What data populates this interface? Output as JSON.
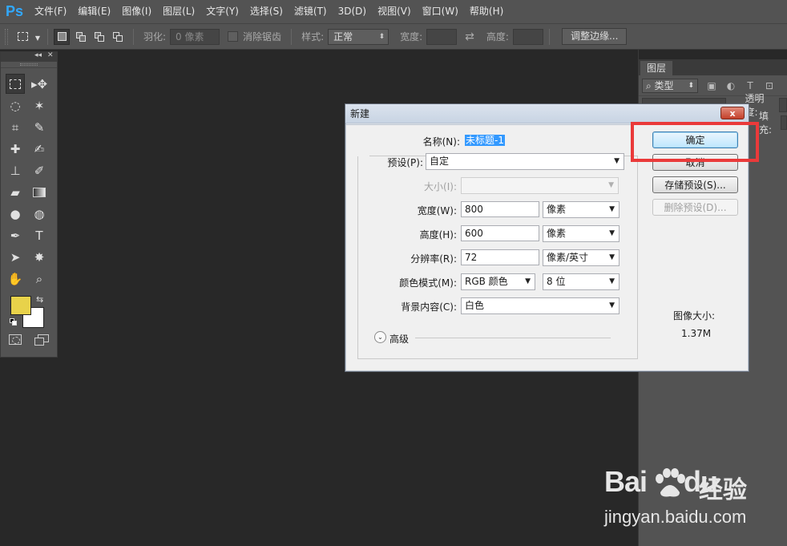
{
  "app": {
    "logo": "Ps"
  },
  "menu": [
    "文件(F)",
    "编辑(E)",
    "图像(I)",
    "图层(L)",
    "文字(Y)",
    "选择(S)",
    "滤镜(T)",
    "3D(D)",
    "视图(V)",
    "窗口(W)",
    "帮助(H)"
  ],
  "options": {
    "feather_label": "羽化:",
    "feather_value": "0 像素",
    "antialias_label": "消除锯齿",
    "style_label": "样式:",
    "style_value": "正常",
    "width_label": "宽度:",
    "height_label": "高度:",
    "refine_edge": "调整边缘..."
  },
  "toolbox": {
    "foreground_color": "#e8d24a",
    "background_color": "#ffffff",
    "tools": [
      [
        "marquee-icon",
        "move-icon"
      ],
      [
        "lasso-icon",
        "magic-wand-icon"
      ],
      [
        "crop-icon",
        "eyedropper-icon"
      ],
      [
        "healing-brush-icon",
        "brush-icon"
      ],
      [
        "clone-stamp-icon",
        "history-brush-icon"
      ],
      [
        "eraser-icon",
        "gradient-icon"
      ],
      [
        "blur-icon",
        "dodge-icon"
      ],
      [
        "pen-icon",
        "type-icon"
      ],
      [
        "path-selection-icon",
        "shape-icon"
      ],
      [
        "hand-icon",
        "zoom-icon"
      ]
    ]
  },
  "layers_panel": {
    "tab": "图层",
    "kind": "类型",
    "opacity_label": "透明度:",
    "fill_label": "填充:"
  },
  "dialog": {
    "title": "新建",
    "close": "x",
    "name_label": "名称(N):",
    "name_value": "未标题-1",
    "preset_label": "预设(P):",
    "preset_value": "自定",
    "size_label": "大小(I):",
    "width_label": "宽度(W):",
    "width_value": "800",
    "width_unit": "像素",
    "height_label": "高度(H):",
    "height_value": "600",
    "height_unit": "像素",
    "resolution_label": "分辨率(R):",
    "resolution_value": "72",
    "resolution_unit": "像素/英寸",
    "color_mode_label": "颜色模式(M):",
    "color_mode_value": "RGB 颜色",
    "bit_depth_value": "8 位",
    "bg_contents_label": "背景内容(C):",
    "bg_contents_value": "白色",
    "advanced_label": "高级",
    "ok": "确定",
    "cancel": "取消",
    "save_preset": "存储预设(S)...",
    "delete_preset": "删除预设(D)...",
    "image_size_label": "图像大小:",
    "image_size_value": "1.37M"
  },
  "highlight_color": "#ea3a3a",
  "watermark": {
    "logo": "Bai",
    "logo_tail": "du",
    "brand": "经验",
    "url": "jingyan.baidu.com"
  }
}
